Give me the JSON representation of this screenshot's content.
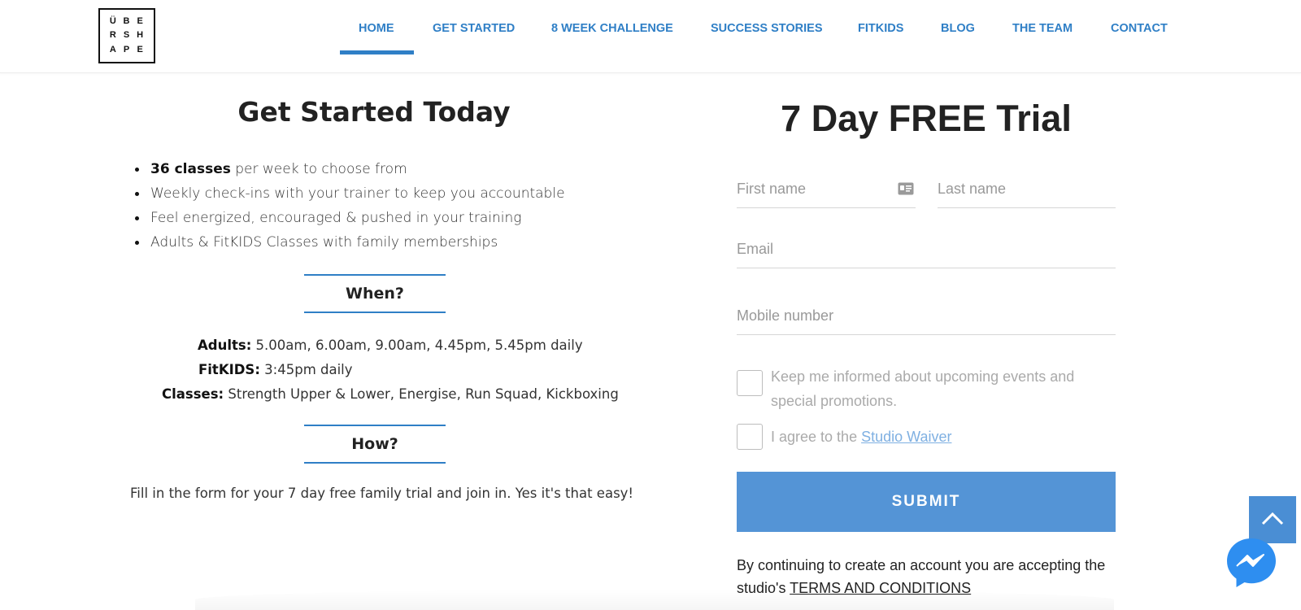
{
  "logo": {
    "letters": [
      "Ü",
      "B",
      "E",
      "R",
      "S",
      "H",
      "A",
      "P",
      "E"
    ]
  },
  "nav": {
    "items": [
      {
        "label": "HOME",
        "active": true
      },
      {
        "label": "GET STARTED"
      },
      {
        "label": "8 WEEK CHALLENGE"
      },
      {
        "label": "SUCCESS STORIES"
      },
      {
        "label": "FITKIDS"
      },
      {
        "label": "BLOG"
      },
      {
        "label": "THE TEAM"
      },
      {
        "label": "CONTACT"
      }
    ],
    "accent_color": "#2f7fc6"
  },
  "left": {
    "title": "Get Started Today",
    "bullets": [
      {
        "bold": "36 classes",
        "text": " per week to choose from"
      },
      {
        "bold": "",
        "text": "Weekly check-ins with your trainer to keep you accountable"
      },
      {
        "bold": "",
        "text": "Feel energized, encouraged & pushed in your training"
      },
      {
        "bold": "",
        "text": "Adults & FitKIDS Classes with family memberships"
      }
    ],
    "when_heading": "When?",
    "schedule": [
      {
        "label": "Adults:",
        "text": " 5.00am, 6.00am, 9.00am, 4.45pm, 5.45pm daily"
      },
      {
        "label": "FitKIDS:",
        "text": " 3:45pm daily"
      },
      {
        "label": "Classes:",
        "text": " Strength Upper & Lower, Energise, Run Squad, Kickboxing"
      }
    ],
    "how_heading": "How?",
    "how_text": "Fill in the form for your 7 day free family trial and join in. Yes it's that easy!"
  },
  "form": {
    "title": "7 Day FREE Trial",
    "first_name_placeholder": "First name",
    "last_name_placeholder": "Last name",
    "email_placeholder": "Email",
    "mobile_placeholder": "Mobile number",
    "keep_informed_line1": "Keep me informed about upcoming events and",
    "keep_informed_line2": "special promotions.",
    "agree_prefix": "I agree to the ",
    "agree_link": "Studio Waiver",
    "submit_label": "SUBMIT",
    "submit_color": "#5494d6",
    "terms_prefix": "By continuing to create an account you are accepting the studio's ",
    "terms_link": "TERMS AND CONDITIONS"
  },
  "widgets": {
    "scroll_top_icon": "chevron-up-icon",
    "messenger_icon": "messenger-icon"
  }
}
